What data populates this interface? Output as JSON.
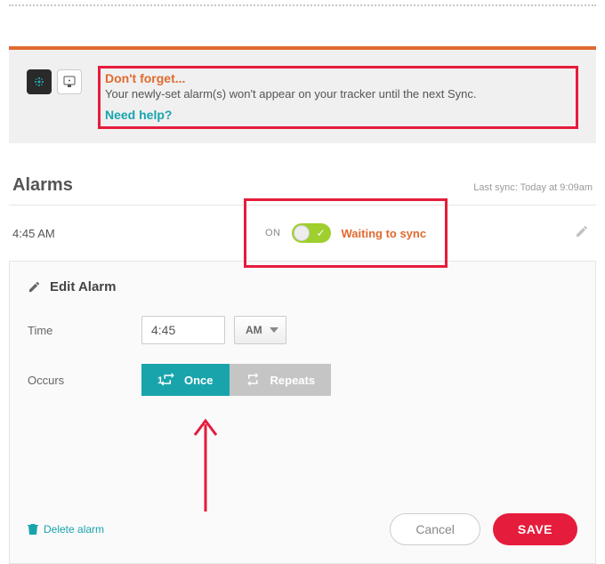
{
  "notice": {
    "title": "Don't forget...",
    "body": "Your newly-set alarm(s) won't appear on your tracker until the next Sync.",
    "help_link": "Need help?"
  },
  "alarms_section": {
    "title": "Alarms",
    "last_sync": "Last sync: Today at 9:09am"
  },
  "alarm": {
    "time_display": "4:45 AM",
    "toggle_state_label": "ON",
    "toggle_on": true,
    "status_text": "Waiting to sync"
  },
  "edit": {
    "title": "Edit Alarm",
    "time_label": "Time",
    "time_value": "4:45",
    "ampm_value": "AM",
    "occurs_label": "Occurs",
    "once_label": "Once",
    "repeats_label": "Repeats",
    "selected_occurs": "once",
    "delete_label": "Delete alarm",
    "cancel_label": "Cancel",
    "save_label": "SAVE"
  },
  "colors": {
    "accent_teal": "#19a4ac",
    "accent_orange": "#e06a2f",
    "accent_red": "#e51c3b"
  }
}
